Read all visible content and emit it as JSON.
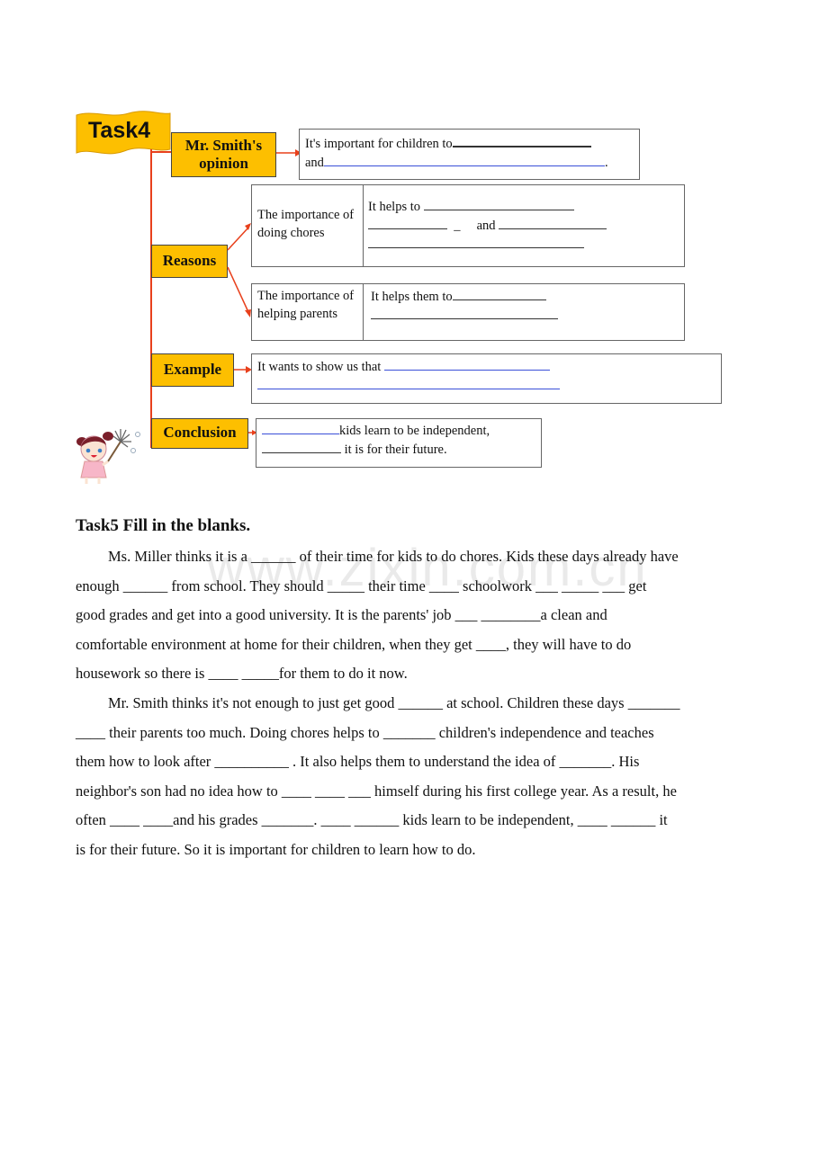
{
  "task4": {
    "title": "Task4",
    "opinion_label": "Mr. Smith's opinion",
    "opinion_text_1": "It's important for children to",
    "opinion_text_2": "and",
    "opinion_end": ".",
    "reasons_label": "Reasons",
    "reason1_title": "The importance of doing chores",
    "reason1_text_1": "It helps to",
    "reason1_dash": "_",
    "reason1_and": "and",
    "reason2_title": "The importance of helping parents",
    "reason2_text_1": "It helps them to",
    "example_label": "Example",
    "example_text": "It wants to show us that",
    "conclusion_label": "Conclusion",
    "conclusion_text_1": "kids learn to be independent,",
    "conclusion_text_2": "it is for their future.",
    "illustration": "girl-with-duster-icon"
  },
  "watermark": "www.zixin.com.cn",
  "task5": {
    "title": "Task5 Fill in the blanks.",
    "paragraph1": [
      "Ms. Miller thinks it is a ______ of their time for kids to do chores. Kids these days already have",
      "enough ______ from school. They should _____ their time ____ schoolwork ___ _____ ___ get",
      "good grades and get into a good university. It is the parents' job ___ ________a clean and",
      "comfortable environment at home for their children, when they get ____, they will have to do",
      "housework so there is ____ _____for them to do it now."
    ],
    "paragraph2": [
      "Mr. Smith thinks it's not enough to just get good ______ at school. Children these days _______",
      "____ their parents too much. Doing chores helps to _______ children's independence and teaches",
      "them how to look after __________ . It also helps them to understand the idea of _______. His",
      "neighbor's son had no idea how to ____ ____ ___ himself during his first college year. As a result, he",
      "often ____ ____and his grades _______. ____ ______ kids learn to be independent, ____ ______ it",
      "is for their future. So it is important for children to learn how to do."
    ]
  }
}
